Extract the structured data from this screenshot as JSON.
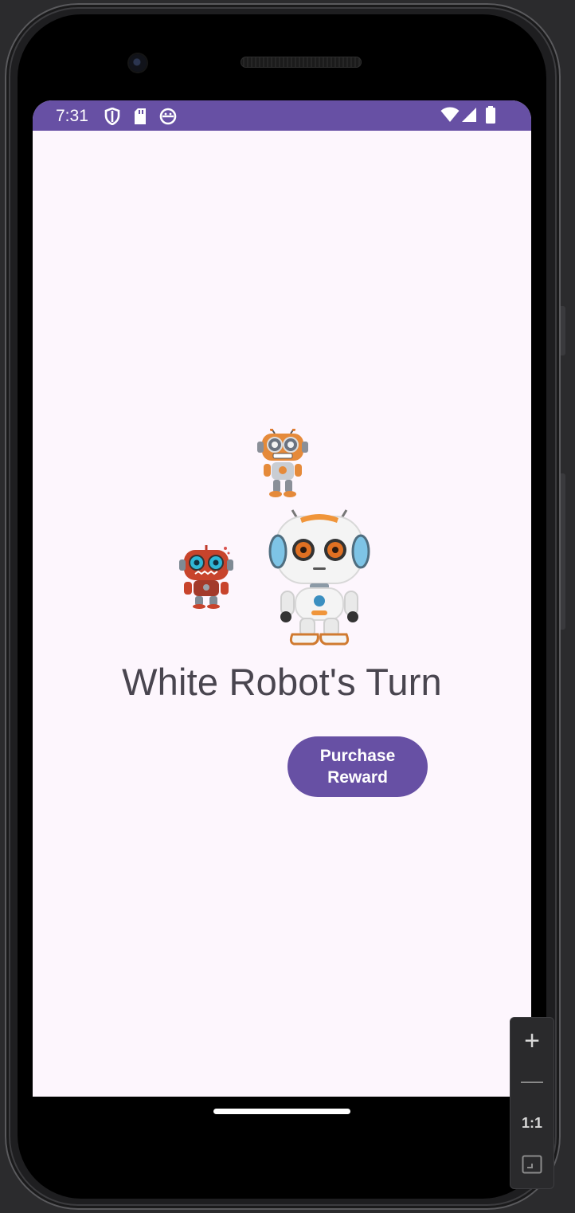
{
  "status_bar": {
    "time": "7:31",
    "left_icons": [
      "shield-icon",
      "sd-card-icon",
      "robot-face-icon"
    ],
    "right_icons": [
      "wifi-icon",
      "cell-signal-icon",
      "battery-icon"
    ],
    "background_color": "#6750a4"
  },
  "game": {
    "turn_text": "White Robot's Turn",
    "purchase_button_label": "Purchase\nReward",
    "robots": [
      "orange-robot",
      "red-robot",
      "white-robot"
    ]
  },
  "emulator_controls": {
    "zoom_in": "+",
    "zoom_out": "—",
    "actual_size": "1:1",
    "fit_icon": "fit-screen-icon"
  },
  "colors": {
    "accent": "#6750a4",
    "screen_background": "#fdf6fd",
    "text": "#49454f"
  }
}
